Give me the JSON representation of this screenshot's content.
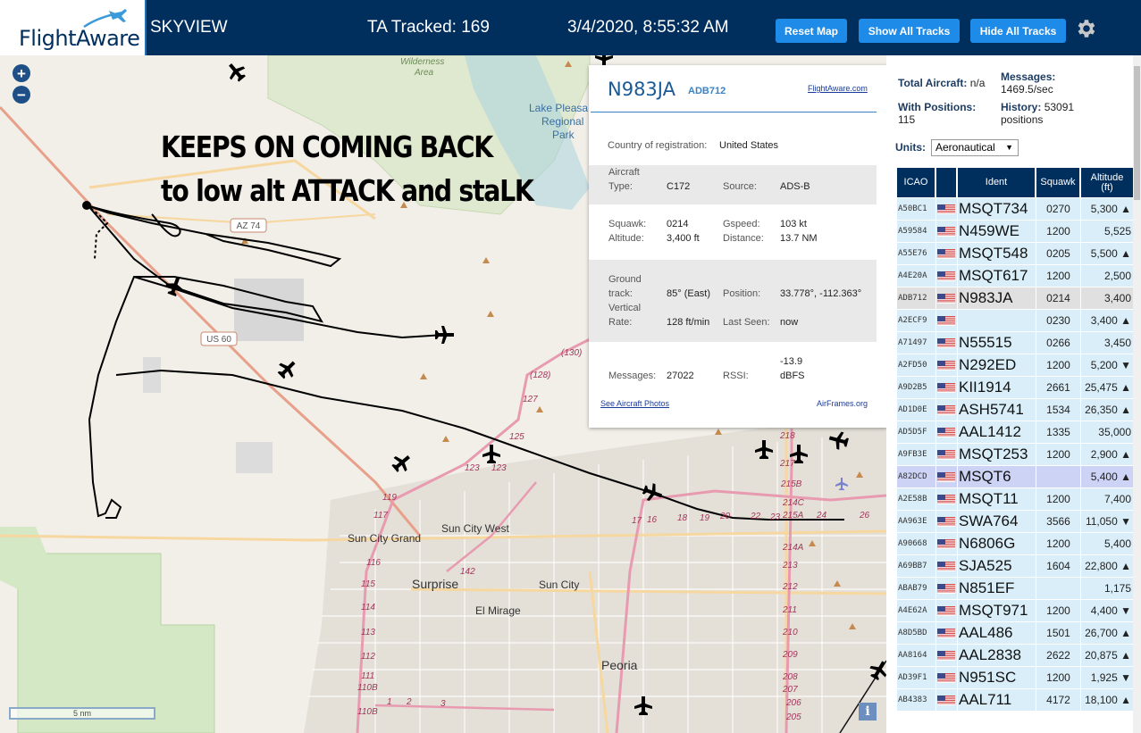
{
  "header": {
    "logo": "FlightAware",
    "app_name": "SKYVIEW",
    "tracked": "TA Tracked: 169",
    "datetime": "3/4/2020, 8:55:32 AM",
    "buttons": {
      "reset": "Reset Map",
      "show_all": "Show All Tracks",
      "hide_all": "Hide All Tracks"
    },
    "settings_icon": "gear-icon"
  },
  "map": {
    "zoom_in": "+",
    "zoom_out": "−",
    "annotation_line1": "KEEPS ON COMING BACK",
    "annotation_line2": "to low alt ATTACK and staLK",
    "scale": "5 nm",
    "info": "i",
    "places": {
      "wilderness": "Wilderness",
      "area": "Area",
      "lake1": "Lake Pleasa",
      "lake2": "Regional",
      "lake3": "Park",
      "sun_city_grand": "Sun City Grand",
      "sun_city_west": "Sun City West",
      "surprise": "Surprise",
      "sun_city": "Sun City",
      "el_mirage": "El Mirage",
      "peoria": "Peoria"
    },
    "roads": {
      "az74": "AZ 74",
      "us60": "US 60",
      "r128": "(128)",
      "r130": "(130)",
      "r127": "127",
      "r125": "125",
      "r123a": "123",
      "r123b": "123",
      "r119": "119",
      "r117": "117",
      "r116": "116",
      "r115": "115",
      "r114": "114",
      "r113": "113",
      "r112": "112",
      "r111": "111",
      "r110b": "110B",
      "r110b2": "110B",
      "r1": "1",
      "r2": "2",
      "r3": "3",
      "r142": "142",
      "r218": "218",
      "r217": "217",
      "r215b": "215B",
      "r214c": "214C",
      "r215a": "215A",
      "r214a": "214A",
      "r213": "213",
      "r212": "212",
      "r211": "211",
      "r210": "210",
      "r209": "209",
      "r208": "208",
      "r207": "207",
      "r206": "206",
      "r205": "205",
      "r17": "17",
      "r16": "16",
      "r18": "18",
      "r19": "19",
      "r20": "20",
      "r22": "22",
      "r23": "23",
      "r24": "24",
      "r26": "26"
    }
  },
  "popup": {
    "ident": "N983JA",
    "icao": "ADB712",
    "fa_link": "FlightAware.com",
    "country_label": "Country of registration:",
    "country_value": "United States",
    "aircraft_type_label1": "Aircraft",
    "aircraft_type_label2": "Type:",
    "aircraft_type_value": "C172",
    "source_label": "Source:",
    "source_value": "ADS-B",
    "squawk_label": "Squawk:",
    "squawk_value": "0214",
    "gspeed_label": "Gspeed:",
    "gspeed_value": "103 kt",
    "altitude_label": "Altitude:",
    "altitude_value": "3,400 ft",
    "distance_label": "Distance:",
    "distance_value": "13.7 NM",
    "ground_label1": "Ground",
    "ground_label2": "track:",
    "ground_value": "85° (East)",
    "position_label": "Position:",
    "position_value": "33.778°, -112.363°",
    "vrate_label1": "Vertical",
    "vrate_label2": "Rate:",
    "vrate_value": "128 ft/min",
    "lastseen_label": "Last Seen:",
    "lastseen_value": "now",
    "messages_label": "Messages:",
    "messages_value": "27022",
    "rssi_label": "RSSI:",
    "rssi_value1": "-13.9",
    "rssi_value2": "dBFS",
    "photos_link": "See Aircraft Photos",
    "airframes_link": "AirFrames.org"
  },
  "panel": {
    "total_label": "Total Aircraft:",
    "total_value": "n/a",
    "messages_label": "Messages:",
    "messages_value": "1469.5/sec",
    "withpos_label": "With Positions:",
    "withpos_value": "115",
    "history_label": "History:",
    "history_value": "53091",
    "history_unit": "positions",
    "units_label": "Units:",
    "units_value": "Aeronautical",
    "columns": {
      "icao": "ICAO",
      "flag": "",
      "ident": "Ident",
      "squawk": "Squawk",
      "alt1": "Altitude",
      "alt2": "(ft)"
    },
    "rows": [
      {
        "icao": "A50BC1",
        "ident": "MSQT734",
        "squawk": "0270",
        "alt": "5,300 ▲"
      },
      {
        "icao": "A59584",
        "ident": "N459WE",
        "squawk": "1200",
        "alt": "5,525"
      },
      {
        "icao": "A55E76",
        "ident": "MSQT548",
        "squawk": "0205",
        "alt": "5,500 ▲"
      },
      {
        "icao": "A4E20A",
        "ident": "MSQT617",
        "squawk": "1200",
        "alt": "2,500"
      },
      {
        "icao": "ADB712",
        "ident": "N983JA",
        "squawk": "0214",
        "alt": "3,400"
      },
      {
        "icao": "A2ECF9",
        "ident": "",
        "squawk": "0230",
        "alt": "3,400 ▲"
      },
      {
        "icao": "A71497",
        "ident": "N55515",
        "squawk": "0266",
        "alt": "3,450"
      },
      {
        "icao": "A2FD50",
        "ident": "N292ED",
        "squawk": "1200",
        "alt": "5,200 ▼"
      },
      {
        "icao": "A9D2B5",
        "ident": "KII1914",
        "squawk": "2661",
        "alt": "25,475 ▲"
      },
      {
        "icao": "AD1D0E",
        "ident": "ASH5741",
        "squawk": "1534",
        "alt": "26,350 ▲"
      },
      {
        "icao": "AD5D5F",
        "ident": "AAL1412",
        "squawk": "1335",
        "alt": "35,000"
      },
      {
        "icao": "A9FB3E",
        "ident": "MSQT253",
        "squawk": "1200",
        "alt": "2,900 ▲"
      },
      {
        "icao": "A82DCD",
        "ident": "MSQT6",
        "squawk": "",
        "alt": "5,400 ▲"
      },
      {
        "icao": "A2E58B",
        "ident": "MSQT11",
        "squawk": "1200",
        "alt": "7,400"
      },
      {
        "icao": "AA963E",
        "ident": "SWA764",
        "squawk": "3566",
        "alt": "11,050 ▼"
      },
      {
        "icao": "A90668",
        "ident": "N6806G",
        "squawk": "1200",
        "alt": "5,400"
      },
      {
        "icao": "A69BB7",
        "ident": "SJA525",
        "squawk": "1604",
        "alt": "22,800 ▲"
      },
      {
        "icao": "ABAB79",
        "ident": "N851EF",
        "squawk": "",
        "alt": "1,175"
      },
      {
        "icao": "A4E62A",
        "ident": "MSQT971",
        "squawk": "1200",
        "alt": "4,400 ▼"
      },
      {
        "icao": "A8D5BD",
        "ident": "AAL486",
        "squawk": "1501",
        "alt": "26,700 ▲"
      },
      {
        "icao": "AA8164",
        "ident": "AAL2838",
        "squawk": "2622",
        "alt": "20,875 ▲"
      },
      {
        "icao": "AD39F1",
        "ident": "N951SC",
        "squawk": "1200",
        "alt": "1,925 ▼"
      },
      {
        "icao": "AB4383",
        "ident": "AAL711",
        "squawk": "4172",
        "alt": "18,100 ▲"
      }
    ]
  },
  "colors": {
    "header": "#002f5d",
    "button": "#1e8be8",
    "row": "#d9eef8",
    "row_selected": "#e0e0e0",
    "row_highlight": "#cdd3f5",
    "road_major": "#e89bb0",
    "road_minor": "#f7d7a0"
  }
}
